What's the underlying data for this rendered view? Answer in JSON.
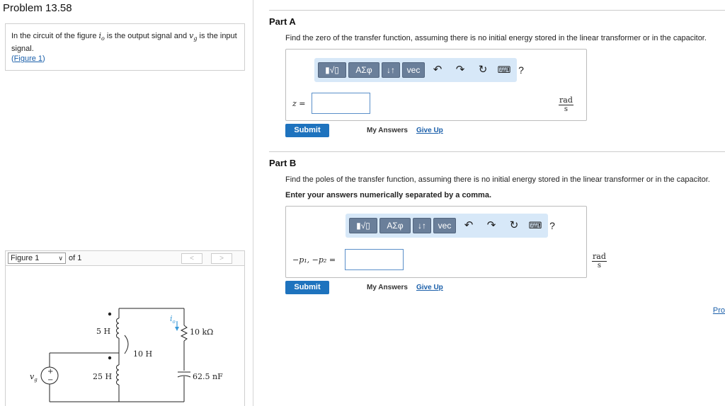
{
  "problem": {
    "title": "Problem 13.58",
    "desc_1": "In the circuit of the figure ",
    "io_var": "i",
    "io_sub": "o",
    "desc_2": " is the output signal and ",
    "vg_var": "v",
    "vg_sub": "g",
    "desc_3": " is the input signal.",
    "figure_link_open": "(",
    "figure_link": "Figure 1",
    "figure_link_close": ")"
  },
  "figure_nav": {
    "selected": "Figure 1",
    "of_text": "of 1",
    "prev": "<",
    "next": ">"
  },
  "circuit": {
    "l1": "5 H",
    "l2": "25 H",
    "m": "10 H",
    "r": "10 kΩ",
    "c": "62.5 nF",
    "io": "i",
    "io_sub": "o",
    "vg": "v",
    "vg_sub": "g",
    "plus": "+",
    "minus": "−"
  },
  "part_a": {
    "title": "Part A",
    "prompt": "Find the zero of the transfer function, assuming there is no initial energy stored in the linear transformer or in the capacitor.",
    "var_label": "z =",
    "unit_num": "rad",
    "unit_den": "s",
    "input_value": ""
  },
  "part_b": {
    "title": "Part B",
    "prompt": "Find the poles of the transfer function, assuming there is no initial energy stored in the linear transformer or in the capacitor.",
    "instruction": "Enter your answers numerically separated by a comma.",
    "var_label": "−p₁, −p₂ =",
    "unit_num": "rad",
    "unit_den": "s",
    "input_value": ""
  },
  "toolbar": {
    "templates": "▮√▯",
    "symbols": "ΑΣφ",
    "arrows": "↓↑",
    "vec": "vec",
    "undo": "↶",
    "redo": "↷",
    "reset": "↻",
    "keyboard": "⌨",
    "help": "?"
  },
  "actions": {
    "submit": "Submit",
    "my_answers": "My Answers",
    "give_up": "Give Up",
    "pro": "Pro"
  },
  "colors": {
    "submit": "#1e73be",
    "toolbar_bg": "#d7e8f8",
    "toolbar_btn": "#6a7f9a",
    "link": "#1a5faa",
    "current_arrow": "#3a9ad9"
  }
}
